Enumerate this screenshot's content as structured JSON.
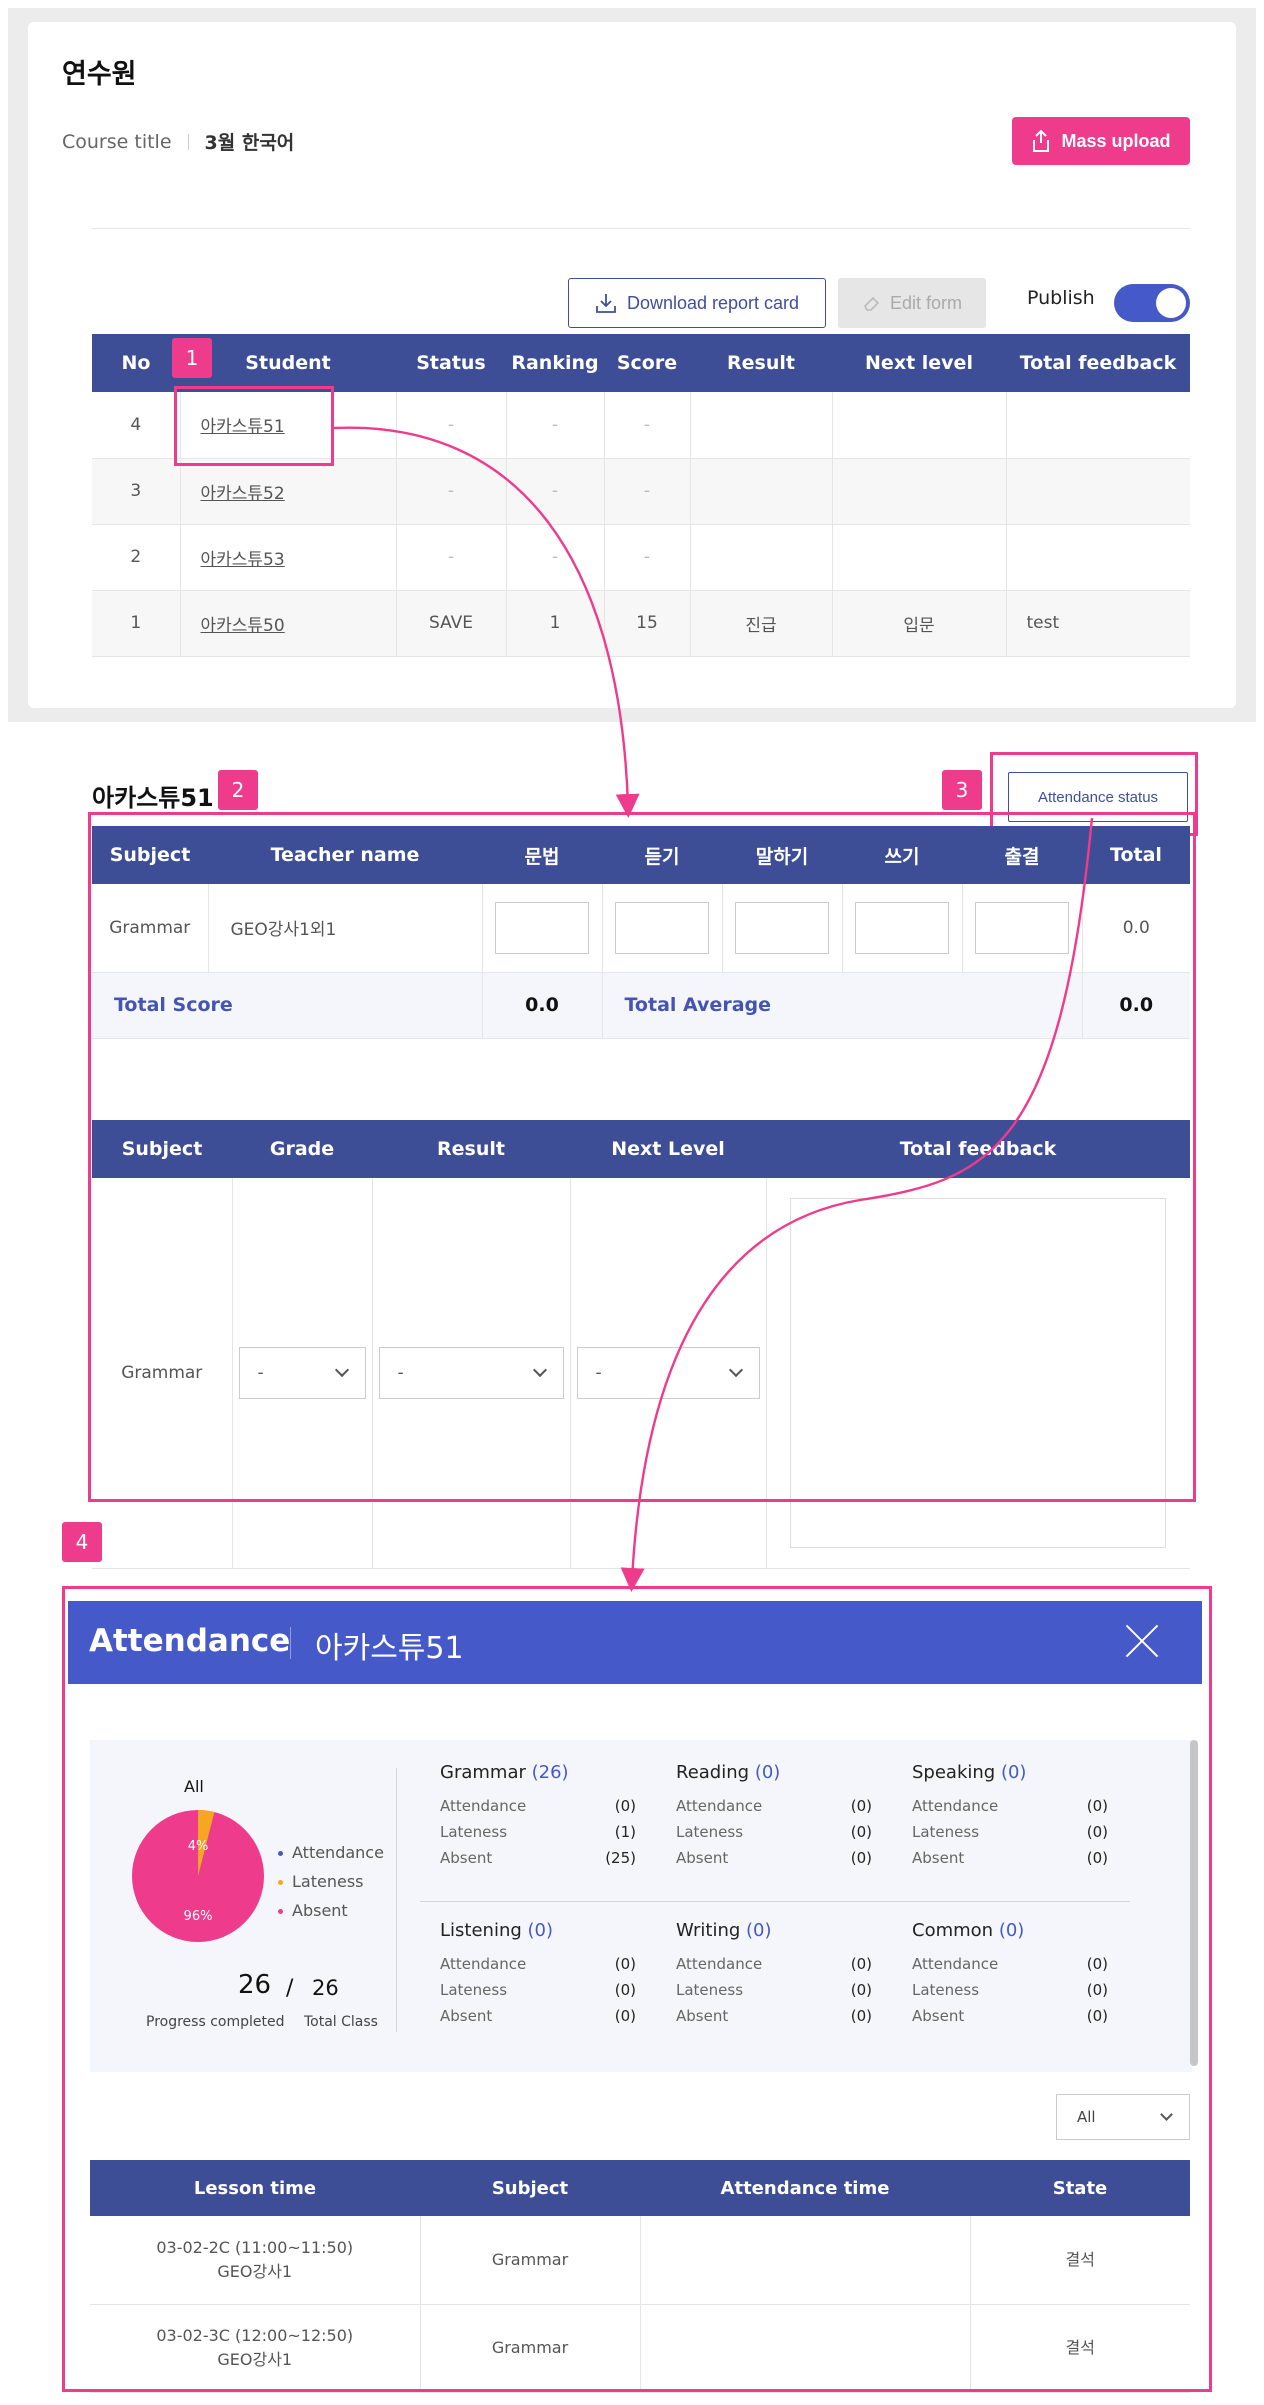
{
  "top": {
    "title": "연수원",
    "course_label": "Course title",
    "course_value": "3월 한국어",
    "mass_upload": "Mass upload",
    "download_report": "Download report card",
    "edit_form": "Edit form",
    "publish": "Publish",
    "publish_on": true
  },
  "student_table": {
    "headers": [
      "No",
      "Student",
      "Status",
      "Ranking",
      "Score",
      "Result",
      "Next level",
      "Total feedback"
    ],
    "rows": [
      {
        "no": "4",
        "student": "아카스튜51",
        "status": "-",
        "ranking": "-",
        "score": "-",
        "result": "",
        "next": "",
        "feedback": ""
      },
      {
        "no": "3",
        "student": "아카스튜52",
        "status": "-",
        "ranking": "-",
        "score": "-",
        "result": "",
        "next": "",
        "feedback": ""
      },
      {
        "no": "2",
        "student": "아카스튜53",
        "status": "-",
        "ranking": "-",
        "score": "-",
        "result": "",
        "next": "",
        "feedback": ""
      },
      {
        "no": "1",
        "student": "아카스튜50",
        "status": "SAVE",
        "ranking": "1",
        "score": "15",
        "result": "진급",
        "next": "입문",
        "feedback": "test"
      }
    ]
  },
  "badges": [
    "1",
    "2",
    "3",
    "4"
  ],
  "detail": {
    "student_name": "아카스튜51",
    "attendance_status_btn": "Attendance status",
    "score_headers": [
      "Subject",
      "Teacher name",
      "문법",
      "듣기",
      "말하기",
      "쓰기",
      "출결",
      "Total"
    ],
    "score_row": {
      "subject": "Grammar",
      "teacher": "GEO강사1외1",
      "total": "0.0"
    },
    "total_score_label": "Total Score",
    "total_score_value": "0.0",
    "total_average_label": "Total Average",
    "total_average_value": "0.0",
    "result_headers": [
      "Subject",
      "Grade",
      "Result",
      "Next Level",
      "Total feedback"
    ],
    "result_row": {
      "subject": "Grammar",
      "grade": "-",
      "result": "-",
      "next_level": "-"
    }
  },
  "attendance": {
    "title": "Attendance",
    "student": "아카스튜51",
    "pie_label": "All",
    "pie_small_pct": "4%",
    "pie_big_pct": "96%",
    "pie_fraction_lateness": 0.04,
    "legend": [
      "Attendance",
      "Lateness",
      "Absent"
    ],
    "progress_done": "26",
    "progress_total": "26",
    "progress_label": "Progress completed",
    "total_label": "Total Class",
    "subjects": [
      {
        "name": "Grammar",
        "count": "(26)",
        "attendance": "(0)",
        "lateness": "(1)",
        "absent": "(25)"
      },
      {
        "name": "Reading",
        "count": "(0)",
        "attendance": "(0)",
        "lateness": "(0)",
        "absent": "(0)"
      },
      {
        "name": "Speaking",
        "count": "(0)",
        "attendance": "(0)",
        "lateness": "(0)",
        "absent": "(0)"
      },
      {
        "name": "Listening",
        "count": "(0)",
        "attendance": "(0)",
        "lateness": "(0)",
        "absent": "(0)"
      },
      {
        "name": "Writing",
        "count": "(0)",
        "attendance": "(0)",
        "lateness": "(0)",
        "absent": "(0)"
      },
      {
        "name": "Common",
        "count": "(0)",
        "attendance": "(0)",
        "lateness": "(0)",
        "absent": "(0)"
      }
    ],
    "row_labels": {
      "attendance": "Attendance",
      "lateness": "Lateness",
      "absent": "Absent"
    },
    "filter_value": "All",
    "lesson_headers": [
      "Lesson time",
      "Subject",
      "Attendance time",
      "State"
    ],
    "lessons": [
      {
        "time": "03-02-2C (11:00~11:50)",
        "teacher": "GEO강사1",
        "subject": "Grammar",
        "att_time": "",
        "state": "결석"
      },
      {
        "time": "03-02-3C (12:00~12:50)",
        "teacher": "GEO강사1",
        "subject": "Grammar",
        "att_time": "",
        "state": "결석"
      }
    ]
  },
  "colors": {
    "accent_pink": "#ee3b8b",
    "header_navy": "#3d4e96",
    "modal_blue": "#4659c8",
    "lateness_orange": "#f5a623"
  }
}
